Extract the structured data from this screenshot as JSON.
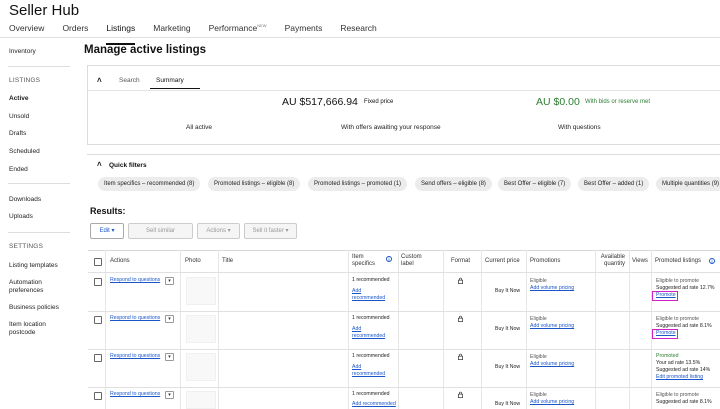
{
  "app": {
    "title": "Seller Hub"
  },
  "nav": {
    "tabs": [
      {
        "label": "Overview"
      },
      {
        "label": "Orders"
      },
      {
        "label": "Listings"
      },
      {
        "label": "Marketing"
      },
      {
        "label": "Performance",
        "badge": "NEW"
      },
      {
        "label": "Payments"
      },
      {
        "label": "Research"
      }
    ],
    "active": "Listings"
  },
  "sidebar": {
    "inventory": "Inventory",
    "listings_heading": "LISTINGS",
    "listings": [
      "Active",
      "Unsold",
      "Drafts",
      "Scheduled",
      "Ended"
    ],
    "active_item": "Active",
    "files": [
      "Downloads",
      "Uploads"
    ],
    "settings_heading": "SETTINGS",
    "settings": [
      "Listing templates",
      "Automation preferences",
      "Business policies",
      "Item location postcode"
    ]
  },
  "page": {
    "title": "Manage active listings"
  },
  "summary": {
    "tabs": [
      "Search",
      "Summary"
    ],
    "active_tab": "Summary",
    "fixed_price_value": "AU $517,666.94",
    "fixed_price_label": "Fixed price",
    "bids_value": "AU $0.00",
    "bids_label": "With bids or reserve met",
    "metrics": [
      "All active",
      "With offers awaiting your response",
      "With questions"
    ]
  },
  "quick_filters": {
    "title": "Quick filters",
    "chips": [
      "Item specifics – recommended (8)",
      "Promoted listings – eligible (8)",
      "Promoted listings – promoted (1)",
      "Send offers – eligible (8)",
      "Best Offer – eligible (7)",
      "Best Offer – added (1)",
      "Multiple quantities (9)"
    ]
  },
  "results": {
    "title": "Results:",
    "buttons": {
      "edit": "Edit",
      "sell_similar": "Sell similar",
      "actions": "Actions",
      "sell_faster": "Sell it faster"
    }
  },
  "table": {
    "headers": {
      "actions": "Actions",
      "photo": "Photo",
      "title": "Title",
      "item_specifics": "Item specifics",
      "custom_label": "Custom label",
      "format": "Format",
      "current_price": "Current price",
      "promotions": "Promotions",
      "available_quantity": "Available quantity",
      "views": "Views",
      "promoted_listings": "Promoted listings"
    },
    "rows": [
      {
        "action": "Respond to questions",
        "specifics_status": "1 recommended",
        "specifics_link": "Add recommended",
        "format": "Buy It Now",
        "promo_status": "Eligible",
        "promo_link": "Add volume pricing",
        "pl_status": "Eligible to promote",
        "pl_rate": "Suggested ad rate 12.7%",
        "pl_link": "Promote"
      },
      {
        "action": "Respond to questions",
        "specifics_status": "1 recommended",
        "specifics_link": "Add recommended",
        "format": "Buy It Now",
        "promo_status": "Eligible",
        "promo_link": "Add volume pricing",
        "pl_status": "Eligible to promote",
        "pl_rate": "Suggested ad rate 8.1%",
        "pl_link": "Promote"
      },
      {
        "action": "Respond to questions",
        "specifics_status": "1 recommended",
        "specifics_link": "Add recommended",
        "format": "Buy It Now",
        "promo_status": "Eligible",
        "promo_link": "Add volume pricing",
        "pl_status": "Promoted",
        "pl_rate": "Your ad rate 13.5%",
        "pl_rate2": "Suggested ad rate 14%",
        "pl_link": "Edit promoted listing"
      },
      {
        "action": "Respond to questions",
        "specifics_status": "1 recommended",
        "specifics_link": "Add recommended",
        "format": "Buy It Now",
        "promo_status": "Eligible",
        "promo_link": "Add volume pricing",
        "pl_status": "Eligible to promote",
        "pl_rate": "Suggested ad rate 8.1%"
      }
    ]
  },
  "colors": {
    "link": "#1a56c9",
    "green": "#2e7d32",
    "highlight": "#d020c8"
  }
}
